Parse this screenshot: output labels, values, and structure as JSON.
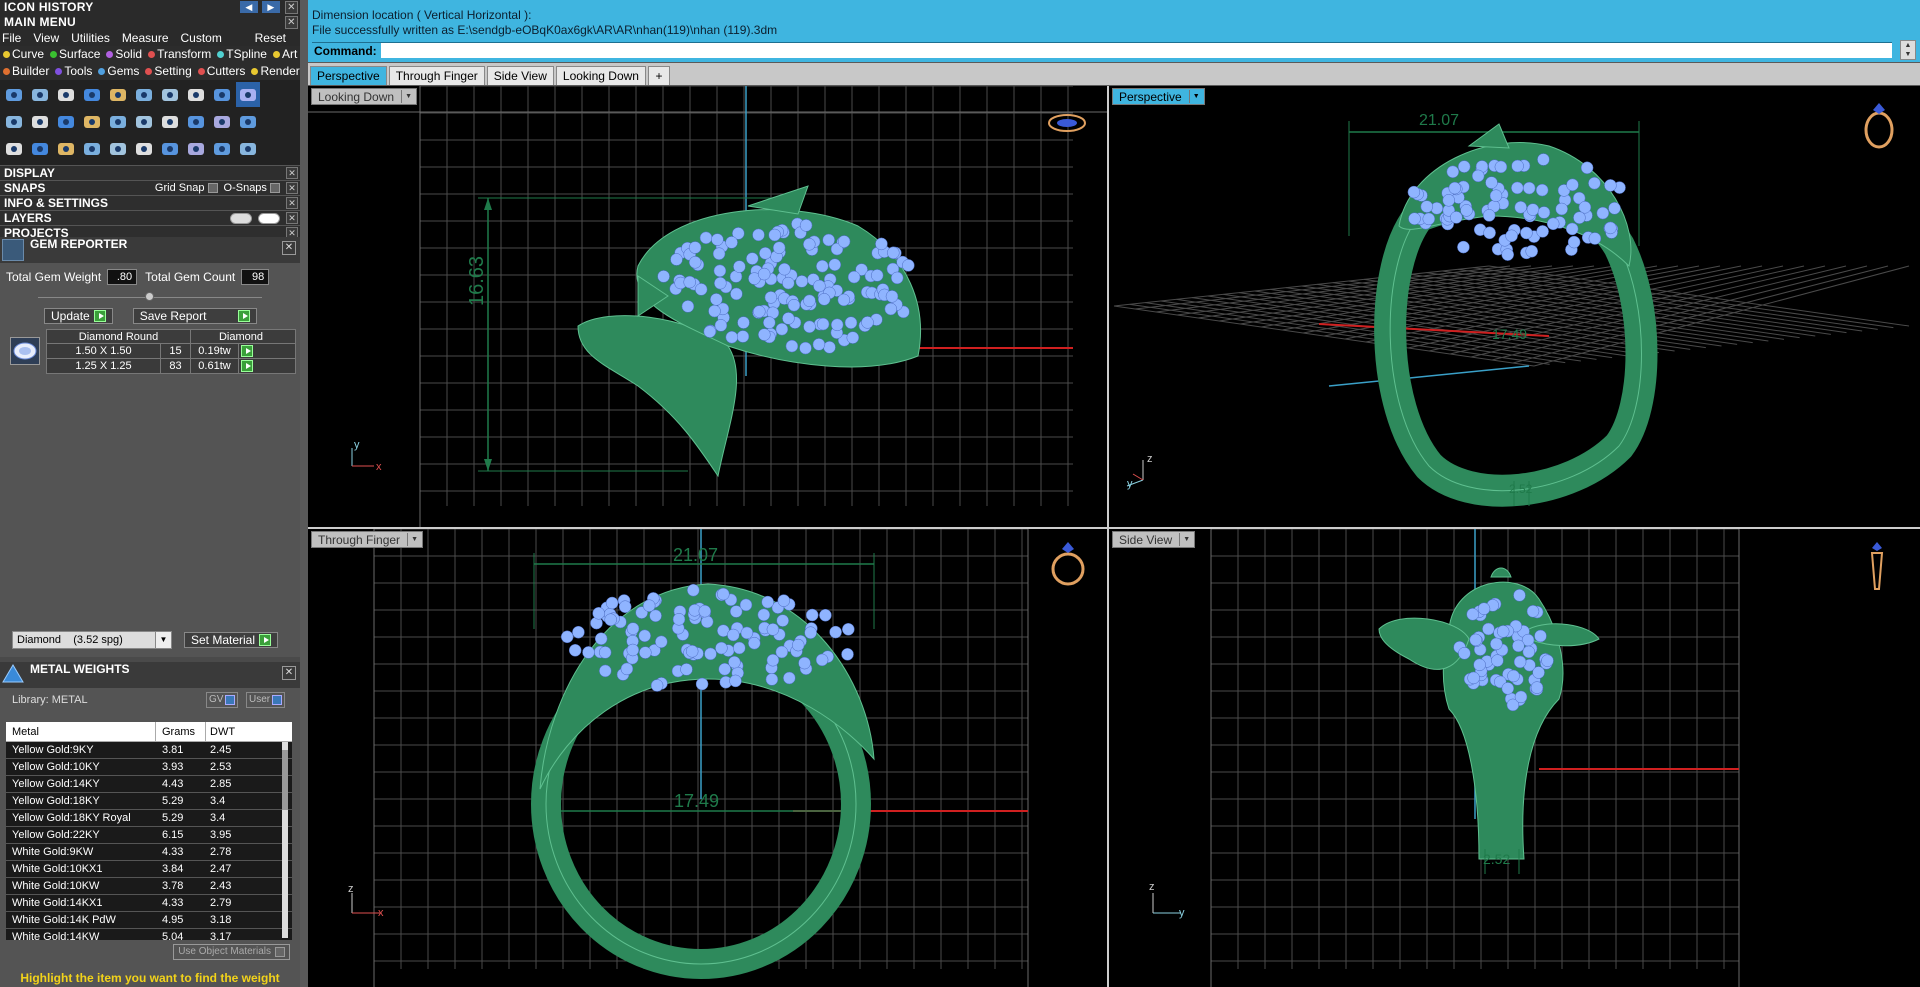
{
  "icon_history": {
    "title": "ICON HISTORY"
  },
  "main_menu": {
    "title": "MAIN MENU",
    "menu": [
      "File",
      "View",
      "Utilities",
      "Measure",
      "Custom"
    ],
    "reset": "Reset",
    "row1": [
      {
        "label": "Curve",
        "color": "#e8c830"
      },
      {
        "label": "Surface",
        "color": "#3ac030"
      },
      {
        "label": "Solid",
        "color": "#b060e0"
      },
      {
        "label": "Transform",
        "color": "#e05050"
      },
      {
        "label": "TSpline",
        "color": "#50d0d0"
      },
      {
        "label": "Art",
        "color": "#e8c830"
      }
    ],
    "row2": [
      {
        "label": "Builder",
        "color": "#e07030"
      },
      {
        "label": "Tools",
        "color": "#8050e0"
      },
      {
        "label": "Gems",
        "color": "#50a0e0"
      },
      {
        "label": "Setting",
        "color": "#e05050"
      },
      {
        "label": "Cutters",
        "color": "#e05050"
      },
      {
        "label": "Render",
        "color": "#e8c830"
      }
    ]
  },
  "sections": {
    "display": "DISPLAY",
    "snaps": "SNAPS",
    "grid_snap": "Grid Snap",
    "o_snaps": "O-Snaps",
    "info": "INFO & SETTINGS",
    "layers": "LAYERS",
    "projects": "PROJECTS"
  },
  "gem_reporter": {
    "title": "GEM REPORTER",
    "total_weight_label": "Total Gem Weight",
    "total_weight": ".80",
    "total_count_label": "Total Gem Count",
    "total_count": "98",
    "update": "Update",
    "save_report": "Save Report",
    "headers": [
      "Diamond Round",
      "Diamond"
    ],
    "rows": [
      {
        "size": "1.50 X 1.50",
        "count": "15",
        "weight": "0.19tw"
      },
      {
        "size": "1.25 X 1.25",
        "count": "83",
        "weight": "0.61tw"
      }
    ],
    "material": "Diamond    (3.52 spg)",
    "set_material": "Set Material"
  },
  "metal_weights": {
    "title": "METAL WEIGHTS",
    "library": "Library: METAL",
    "gv": "GV",
    "user": "User",
    "headers": [
      "Metal",
      "Grams",
      "DWT"
    ],
    "rows": [
      [
        "Yellow Gold:9KY",
        "3.81",
        "2.45"
      ],
      [
        "Yellow Gold:10KY",
        "3.93",
        "2.53"
      ],
      [
        "Yellow Gold:14KY",
        "4.43",
        "2.85"
      ],
      [
        "Yellow Gold:18KY",
        "5.29",
        "3.4"
      ],
      [
        "Yellow Gold:18KY Royal",
        "5.29",
        "3.4"
      ],
      [
        "Yellow Gold:22KY",
        "6.15",
        "3.95"
      ],
      [
        "White Gold:9KW",
        "4.33",
        "2.78"
      ],
      [
        "White Gold:10KX1",
        "3.84",
        "2.47"
      ],
      [
        "White Gold:10KW",
        "3.78",
        "2.43"
      ],
      [
        "White Gold:14KX1",
        "4.33",
        "2.79"
      ],
      [
        "White Gold:14K PdW",
        "4.95",
        "3.18"
      ],
      [
        "White Gold:14KW",
        "5.04",
        "3.17"
      ]
    ],
    "use_object_materials": "Use Object Materials",
    "hint": "Highlight the item you want to find the weight"
  },
  "command": {
    "line1": "Dimension location ( Vertical  Horizontal ):",
    "line2": "File successfully written as E:\\sendgb-eOBqK0ax6gk\\AR\\AR\\nhan(119)\\nhan (119).3dm",
    "prompt": "Command:"
  },
  "tabs": [
    "Perspective",
    "Through Finger",
    "Side View",
    "Looking Down",
    "+"
  ],
  "viewports": {
    "top_left": {
      "label": "Looking Down",
      "dim": "16.63",
      "axis_v": "y",
      "axis_h": "x"
    },
    "top_right": {
      "label": "Perspective",
      "dim_top": "21.07",
      "dim_mid": "17.49",
      "dim_bottom": "2.52",
      "axis_v": "z",
      "axis_h": "y"
    },
    "bottom_left": {
      "label": "Through Finger",
      "dim_top": "21.07",
      "dim_mid": "17.49",
      "axis_v": "z",
      "axis_h": "x"
    },
    "bottom_right": {
      "label": "Side View",
      "dim_bottom": "2.52",
      "axis_v": "z",
      "axis_h": "y"
    }
  },
  "colors": {
    "accent": "#3fb5e0",
    "ring_green": "#2e8a5c",
    "gem_blue": "#8fb4ff",
    "dimension": "#1f7a4a",
    "hint_yellow": "#f2d31a"
  }
}
